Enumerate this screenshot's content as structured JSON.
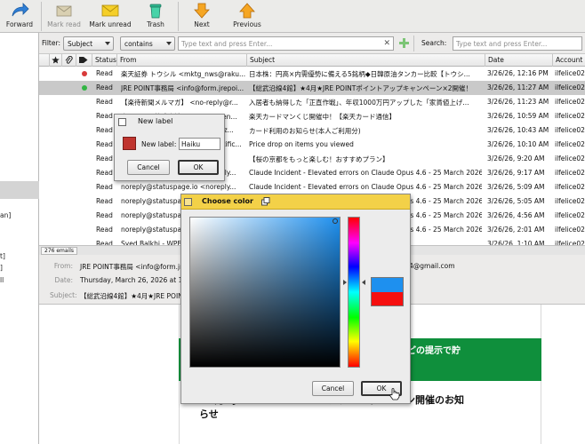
{
  "toolbar": {
    "forward": "Forward",
    "mark_read": "Mark read",
    "mark_unread": "Mark unread",
    "trash": "Trash",
    "next": "Next",
    "previous": "Previous"
  },
  "left_panel": {
    "items": [
      "an]",
      "t]",
      "]",
      "ll"
    ]
  },
  "filter": {
    "label": "Filter:",
    "field": "Subject",
    "operator": "contains",
    "placeholder": "Type text and press Enter...",
    "search_label": "Search:",
    "search_placeholder": "Type text and press Enter..."
  },
  "list": {
    "columns": {
      "status": "Status",
      "from": "From",
      "subject": "Subject",
      "date": "Date",
      "account": "Account"
    },
    "rows": [
      {
        "status": "Read",
        "from": "楽天証券 トウシル <mktg_nws@raku...",
        "subject": "日本株：円高×内需優勢に備える5銘柄◆日韓原油タンカー比較【トウシ...",
        "date": "3/26/26, 12:16 PM",
        "account": "ilfelice02",
        "dot": "#d83a3a",
        "selected": false
      },
      {
        "status": "Read",
        "from": "JRE POINT事務局 <info@form.jrepoi...",
        "subject": "【総武沿線4館】★4月★JRE POINTポイントアップキャンペーン×2開催！",
        "date": "3/26/26, 11:27 AM",
        "account": "ilfelice02",
        "dot": "#32b544",
        "selected": true
      },
      {
        "status": "Read",
        "from": "【楽待新聞メルマガ】 <no-reply@r...",
        "subject": "入居者も納得した「正直作戦」、年収1000万円アップした「家賃値上げ...",
        "date": "3/26/26, 11:23 AM",
        "account": "ilfelice02",
        "dot": "",
        "selected": false
      },
      {
        "status": "Read",
        "from": "楽天カード株式会社 <mail.rakuten...",
        "subject": "楽天カードマンくじ開催中！【楽天カード通信】",
        "date": "3/26/26, 10:59 AM",
        "account": "ilfelice02",
        "dot": "",
        "selected": false
      },
      {
        "status": "Read",
        "from": "Amazon.co.jp <info@mail.amaz...",
        "subject": "カード利用のお知らせ(本人ご利用分)",
        "date": "3/26/26, 10:43 AM",
        "account": "ilfelice02",
        "dot": "",
        "selected": false
      },
      {
        "status": "Read",
        "from": "eBay <ebay@ebay.com> @notific...",
        "subject": "Price drop on items you viewed",
        "date": "3/26/26, 10:10 AM",
        "account": "ilfelice02",
        "dot": "",
        "selected": false
      },
      {
        "status": "Read",
        "from": "JR東日本 <mail@jreast.co.jp>...",
        "subject": "【桜の京都をもっと楽しむ！おすすめプラン】",
        "date": "3/26/26, 9:20 AM",
        "account": "ilfelice02",
        "dot": "",
        "selected": false
      },
      {
        "status": "Read",
        "from": "noreply@statuspage.io <noreply...",
        "subject": "Claude Incident - Elevated errors on Claude Opus 4.6 - 25 March 2026",
        "date": "3/26/26, 9:17 AM",
        "account": "ilfelice02",
        "dot": "",
        "selected": false
      },
      {
        "status": "Read",
        "from": "noreply@statuspage.io <noreply...",
        "subject": "Claude Incident - Elevated errors on Claude Opus 4.6 - 25 March 2026",
        "date": "3/26/26, 5:09 AM",
        "account": "ilfelice02",
        "dot": "",
        "selected": false
      },
      {
        "status": "Read",
        "from": "noreply@statuspage.io <noreply...",
        "subject": "Claude Incident - Elevated errors on Claude Opus 4.6 - 25 March 2026",
        "date": "3/26/26, 5:05 AM",
        "account": "ilfelice02",
        "dot": "",
        "selected": false
      },
      {
        "status": "Read",
        "from": "noreply@statuspage.io <noreply...",
        "subject": "Claude Incident - Elevated errors on Claude Opus 4.6 - 25 March 2026",
        "date": "3/26/26, 4:56 AM",
        "account": "ilfelice02",
        "dot": "",
        "selected": false
      },
      {
        "status": "Read",
        "from": "noreply@statuspage.io <noreply...",
        "subject": "Claude Incident - Elevated errors on Claude Opus 4.6 - 25 March 2026",
        "date": "3/26/26, 2:01 AM",
        "account": "ilfelice02",
        "dot": "",
        "selected": false
      },
      {
        "status": "Read",
        "from": "Syed Balkhi - WPBeginner <...",
        "subject": "— here's how to fi...",
        "date": "3/26/26, 1:10 AM",
        "account": "ilfelice02",
        "dot": "",
        "selected": false
      }
    ],
    "email_count": "276 emails"
  },
  "preview": {
    "from_label": "From:",
    "from_value": "JRE POINT事務局 <info@form.jrepoint.jp>",
    "from_tail": "4@gmail.com",
    "date_label": "Date:",
    "date_value": "Thursday, March 26, 2026 at 11:2",
    "subject_label": "Subject:",
    "subject_value": "【総武沿線4館】★4月★JRE POINT",
    "green_text": "どの提示で貯",
    "green_text2": "",
    "heading_line1": "★4月★JRE POINTポイントアップキャンペーン開催のお知",
    "heading_line2": "らせ"
  },
  "new_label_dialog": {
    "title": "New label",
    "field_label": "New label:",
    "field_value": "Haiku",
    "cancel": "Cancel",
    "ok": "OK",
    "swatch_color": "#c0352f"
  },
  "color_dialog": {
    "title": "Choose color",
    "cancel": "Cancel",
    "ok": "OK",
    "new_color": "#1e90ef",
    "old_color": "#f50f0f"
  }
}
